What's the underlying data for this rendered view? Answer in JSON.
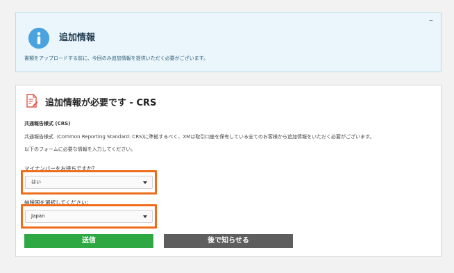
{
  "info_panel": {
    "collapse_symbol": "–",
    "title": "追加情報",
    "text": "書類をアップロードする前に、今回のみ追加情報を提供いただく必要がございます。"
  },
  "crs_panel": {
    "title": "追加情報が必要です - CRS",
    "section_label": "共通報告様式 (CRS)",
    "description_1": "共通報告様式（Common Reporting Standard: CRS)に準拠するべく、XMは取引口座を保有している全てのお客様から追加情報をいただく必要がございます。",
    "description_2": "以下のフォームに必要な情報を入力してください。",
    "fields": [
      {
        "label": "マイナンバーをお持ちですか？",
        "selected": "はい"
      },
      {
        "label": "納税国を選択してください：",
        "selected": "Japan"
      }
    ],
    "buttons": {
      "submit": "送信",
      "later": "後で知らせる"
    }
  },
  "colors": {
    "info_bg": "#eaf6fb",
    "info_icon": "#4aa3df",
    "highlight": "#ee6d1a",
    "submit": "#2ea843",
    "later": "#5e5e5e",
    "doc_icon": "#e2574c"
  },
  "icons": {
    "info": "info-circle-icon",
    "document": "document-pen-icon",
    "dropdown": "caret-down-icon"
  }
}
